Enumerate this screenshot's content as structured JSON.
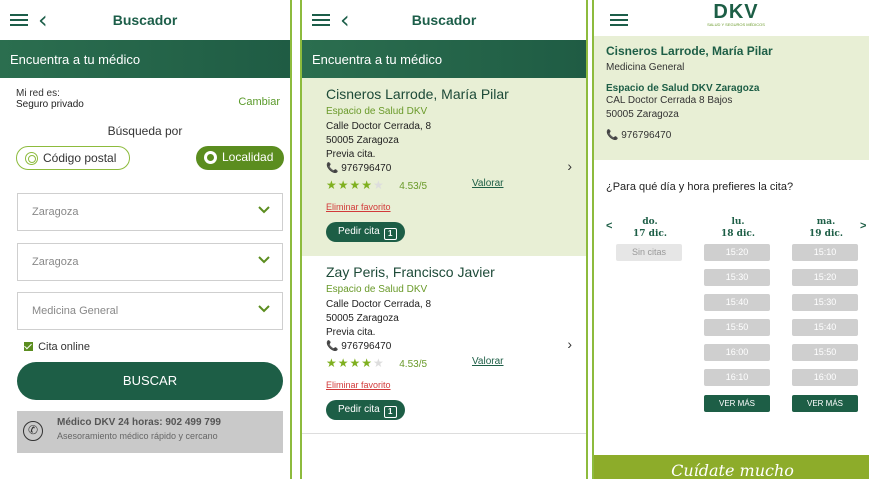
{
  "screen1": {
    "header": {
      "title": "Buscador"
    },
    "banner": "Encuentra a tu médico",
    "network": {
      "label": "Mi red es:",
      "value": "Seguro privado",
      "change_label": "Cambiar"
    },
    "search_by": "Búsqueda por",
    "toggle_postal": "Código postal",
    "toggle_locality": "Localidad",
    "select_province": "Zaragoza",
    "select_city": "Zaragoza",
    "select_specialty": "Medicina General",
    "online_label": "Cita online",
    "search_button": "BUSCAR",
    "help_title": "Médico DKV 24 horas: 902 499 799",
    "help_subtitle": "Asesoramiento médico rápido y cercano"
  },
  "screen2": {
    "header": {
      "title": "Buscador"
    },
    "banner": "Encuentra a tu médico",
    "doctors": [
      {
        "name": "Cisneros Larrode, María Pilar",
        "center": "Espacio de Salud DKV",
        "address": "Calle Doctor Cerrada, 8",
        "city": "50005 Zaragoza",
        "note": "Previa cita.",
        "phone": "976796470",
        "rating": "4.53/5",
        "rate_label": "Valorar",
        "remove_label": "Eliminar favorito",
        "book_label": "Pedir cita"
      },
      {
        "name": "Zay Peris, Francisco Javier",
        "center": "Espacio de Salud DKV",
        "address": "Calle Doctor Cerrada, 8",
        "city": "50005 Zaragoza",
        "note": "Previa cita.",
        "phone": "976796470",
        "rating": "4.53/5",
        "rate_label": "Valorar",
        "remove_label": "Eliminar favorito",
        "book_label": "Pedir cita"
      }
    ]
  },
  "screen3": {
    "logo": "DKV",
    "logo_tagline": "SALUD Y SEGUROS MÉDICOS",
    "doctor": {
      "name": "Cisneros Larrode, María Pilar",
      "specialty": "Medicina General",
      "center": "Espacio de Salud DKV Zaragoza",
      "address": "CAL Doctor Cerrada 8 Bajos",
      "city": "50005 Zaragoza",
      "phone": "976796470"
    },
    "question": "¿Para qué día y hora prefieres la cita?",
    "days": [
      {
        "dow": "do.",
        "date": "17 dic."
      },
      {
        "dow": "lu.",
        "date": "18 dic."
      },
      {
        "dow": "ma.",
        "date": "19 dic."
      }
    ],
    "no_slots": "Sin citas",
    "slots_mon": [
      "15:20",
      "15:30",
      "15:40",
      "15:50",
      "16:00",
      "16:10"
    ],
    "slots_tue": [
      "15:10",
      "15:20",
      "15:30",
      "15:40",
      "15:50",
      "16:00"
    ],
    "more_label": "VER MÁS",
    "footer": "Cuídate mucho"
  },
  "colors": {
    "primary": "#1d5e46",
    "accent": "#8dbb3d",
    "highlight_bg": "#e8efd5",
    "danger": "#d23a3a"
  }
}
